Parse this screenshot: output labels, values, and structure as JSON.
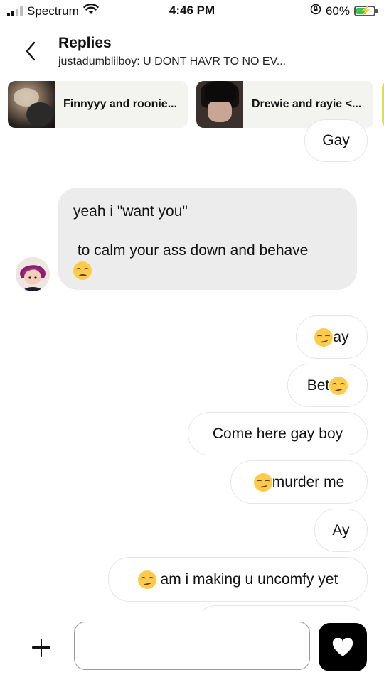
{
  "status_bar": {
    "carrier": "Spectrum",
    "time": "4:46 PM",
    "battery": "60%",
    "icons": [
      "signal-icon",
      "wifi-icon",
      "orientation-lock-icon",
      "battery-charging-icon"
    ]
  },
  "header": {
    "title": "Replies",
    "subtitle": "justadumblilboy: U DONT HAVR TO NO EV..."
  },
  "linked_chats": [
    {
      "label": "Finnyyy and roonie..."
    },
    {
      "label": "Drewie and rayie <..."
    }
  ],
  "messages": [
    {
      "side": "sent",
      "text": "Gay"
    },
    {
      "side": "received",
      "line1": "yeah i \"want you\"",
      "line2": " to calm your ass down and behave",
      "emoji": "pensive"
    },
    {
      "side": "sent",
      "text": "ay",
      "emoji": "smirk",
      "emoji_pos": "before"
    },
    {
      "side": "sent",
      "text": "Bet",
      "emoji": "smirk",
      "emoji_pos": "after"
    },
    {
      "side": "sent",
      "text": "Come here gay boy"
    },
    {
      "side": "sent",
      "text": "murder me",
      "emoji": "smirk",
      "emoji_pos": "before"
    },
    {
      "side": "sent",
      "text": "Ay"
    },
    {
      "side": "sent",
      "text": " am i making u uncomfy yet",
      "emoji": "smirk",
      "emoji_pos": "before"
    }
  ],
  "composer": {
    "placeholder": "",
    "icons": [
      "plus-icon",
      "heart-icon"
    ]
  },
  "colors": {
    "received_bubble": "#ececec",
    "sent_bubble_border": "#e6e6e6",
    "heart_button": "#000000",
    "battery_fill": "#34c759"
  }
}
